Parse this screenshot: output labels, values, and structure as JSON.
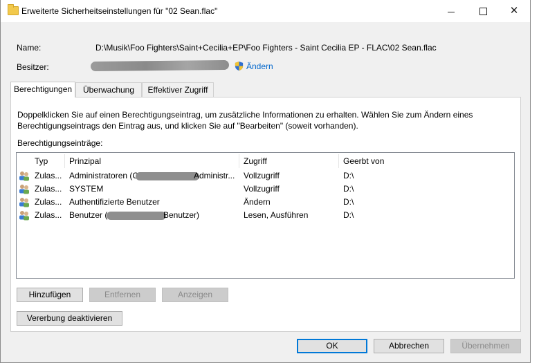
{
  "window": {
    "title": "Erweiterte Sicherheitseinstellungen für \"02 Sean.flac\"",
    "controls": {
      "minimize": "minimize",
      "maximize": "maximize",
      "close": "close"
    }
  },
  "info": {
    "name_label": "Name:",
    "name_value": "D:\\Musik\\Foo Fighters\\Saint+Cecilia+EP\\Foo Fighters - Saint Cecilia EP - FLAC\\02 Sean.flac",
    "owner_label": "Besitzer:",
    "change_link": "Ändern"
  },
  "tabs": [
    {
      "label": "Berechtigungen",
      "active": true
    },
    {
      "label": "Überwachung",
      "active": false
    },
    {
      "label": "Effektiver Zugriff",
      "active": false
    }
  ],
  "permissions": {
    "description": "Doppelklicken Sie auf einen Berechtigungseintrag, um zusätzliche Informationen zu erhalten. Wählen Sie zum Ändern eines Berechtigungseintrags den Eintrag aus, und klicken Sie auf \"Bearbeiten\" (soweit vorhanden).",
    "entries_label": "Berechtigungseinträge:",
    "columns": [
      "Typ",
      "Prinzipal",
      "Zugriff",
      "Geerbt von"
    ],
    "rows": [
      {
        "type": "Zulas...",
        "principal": "Administratoren (C",
        "principal_tail": "Administr...",
        "access": "Vollzugriff",
        "inherited": "D:\\"
      },
      {
        "type": "Zulas...",
        "principal": "SYSTEM",
        "principal_tail": "",
        "access": "Vollzugriff",
        "inherited": "D:\\"
      },
      {
        "type": "Zulas...",
        "principal": "Authentifizierte Benutzer",
        "principal_tail": "",
        "access": "Ändern",
        "inherited": "D:\\"
      },
      {
        "type": "Zulas...",
        "principal": "Benutzer (",
        "principal_tail": "Benutzer)",
        "access": "Lesen, Ausführen",
        "inherited": "D:\\"
      }
    ],
    "buttons": {
      "add": "Hinzufügen",
      "remove": "Entfernen",
      "view": "Anzeigen",
      "disable_inheritance": "Vererbung deaktivieren"
    }
  },
  "footer": {
    "ok": "OK",
    "cancel": "Abbrechen",
    "apply": "Übernehmen"
  },
  "colors": {
    "accent": "#0078d7",
    "link": "#0066cc",
    "redaction": "#8f8f8f"
  },
  "icons": {
    "title": "folder-icon",
    "owner": "uac-shield-icon",
    "row": "users-icon"
  }
}
